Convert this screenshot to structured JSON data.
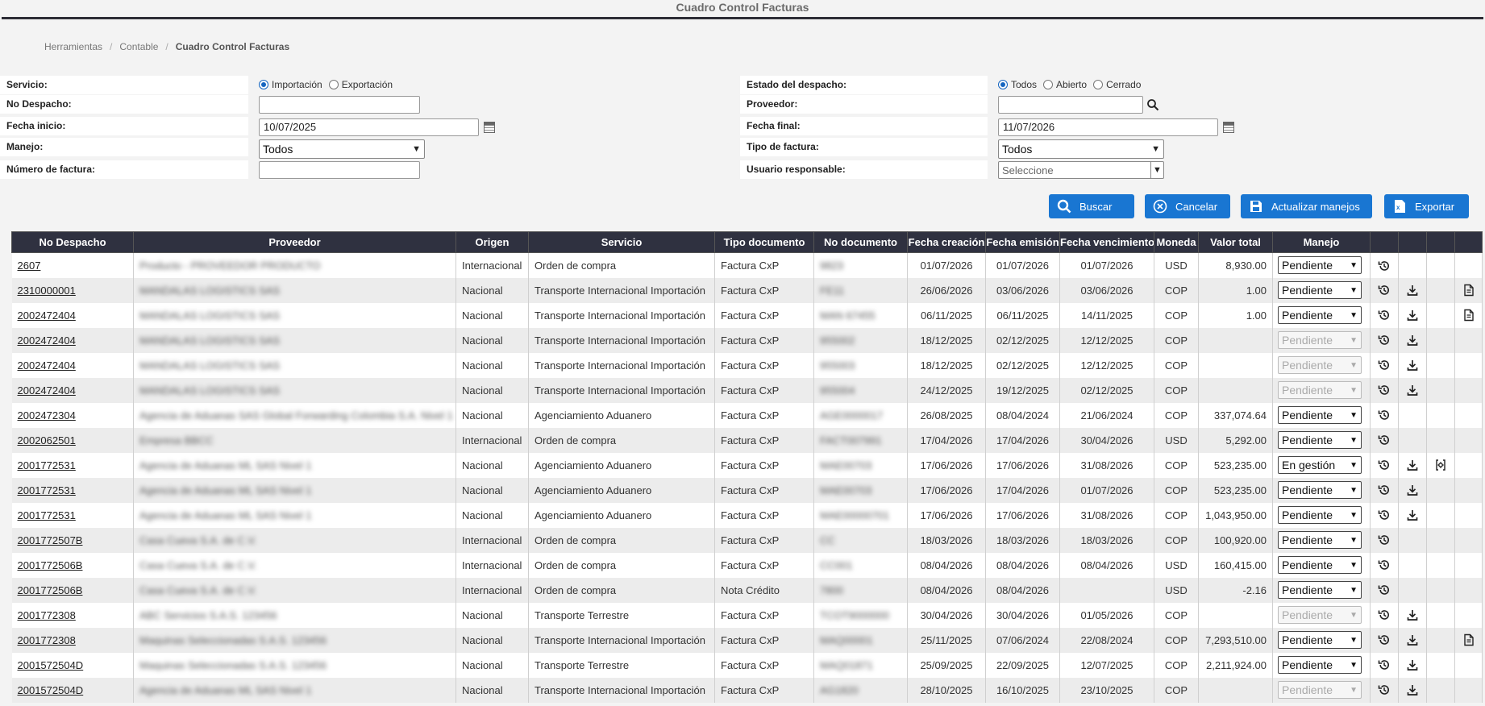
{
  "window": {
    "title": "Cuadro Control Facturas"
  },
  "breadcrumb": {
    "item1": "Herramientas",
    "item2": "Contable",
    "current": "Cuadro Control Facturas",
    "sep": "/"
  },
  "form": {
    "servicio_label": "Servicio:",
    "servicio_opt1": "Importación",
    "servicio_opt2": "Exportación",
    "despacho_label": "No Despacho:",
    "despacho_value": "",
    "fecha_inicio_label": "Fecha inicio:",
    "fecha_inicio_value": "10/07/2025",
    "manejo_label": "Manejo:",
    "manejo_value": "Todos",
    "factura_label": "Número de factura:",
    "factura_value": "",
    "estado_label": "Estado del despacho:",
    "estado_opt1": "Todos",
    "estado_opt2": "Abierto",
    "estado_opt3": "Cerrado",
    "proveedor_label": "Proveedor:",
    "proveedor_value": "",
    "fecha_final_label": "Fecha final:",
    "fecha_final_value": "11/07/2026",
    "tipo_factura_label": "Tipo de factura:",
    "tipo_factura_value": "Todos",
    "usuario_label": "Usuario responsable:",
    "usuario_placeholder": "Seleccione"
  },
  "buttons": {
    "buscar": "Buscar",
    "cancelar": "Cancelar",
    "actualizar": "Actualizar manejos",
    "exportar": "Exportar"
  },
  "colors": {
    "accent": "#1976d2",
    "header": "#2f3140"
  },
  "table": {
    "headers": [
      "No Despacho",
      "Proveedor",
      "Origen",
      "Servicio",
      "Tipo documento",
      "No documento",
      "Fecha creación",
      "Fecha emisión",
      "Fecha vencimiento",
      "Moneda",
      "Valor total",
      "Manejo"
    ],
    "rows": [
      {
        "despacho": "2607",
        "proveedor": "Producto - PROVEEDOR PRODUCTO",
        "origen": "Internacional",
        "servicio": "Orden de compra",
        "tipo": "Factura CxP",
        "nodoc": "9823",
        "creacion": "01/07/2026",
        "emision": "01/07/2026",
        "vencimiento": "01/07/2026",
        "moneda": "USD",
        "valor": "8,930.00",
        "manejo": "Pendiente",
        "dis": false,
        "dl": false,
        "ex": ""
      },
      {
        "despacho": "2310000001",
        "proveedor": "MANDALAS LOGISTICS SAS",
        "origen": "Nacional",
        "servicio": "Transporte Internacional Importación",
        "tipo": "Factura CxP",
        "nodoc": "FE11",
        "creacion": "26/06/2026",
        "emision": "03/06/2026",
        "vencimiento": "03/06/2026",
        "moneda": "COP",
        "valor": "1.00",
        "manejo": "Pendiente",
        "dis": false,
        "dl": true,
        "ex": "doc"
      },
      {
        "despacho": "2002472404",
        "proveedor": "MANDALAS LOGISTICS SAS",
        "origen": "Nacional",
        "servicio": "Transporte Internacional Importación",
        "tipo": "Factura CxP",
        "nodoc": "MAN 67455",
        "creacion": "06/11/2025",
        "emision": "06/11/2025",
        "vencimiento": "14/11/2025",
        "moneda": "COP",
        "valor": "1.00",
        "manejo": "Pendiente",
        "dis": false,
        "dl": true,
        "ex": "doc"
      },
      {
        "despacho": "2002472404",
        "proveedor": "MANDALAS LOGISTICS SAS",
        "origen": "Nacional",
        "servicio": "Transporte Internacional Importación",
        "tipo": "Factura CxP",
        "nodoc": "955002",
        "creacion": "18/12/2025",
        "emision": "02/12/2025",
        "vencimiento": "12/12/2025",
        "moneda": "COP",
        "valor": "",
        "manejo": "Pendiente",
        "dis": true,
        "dl": true,
        "ex": ""
      },
      {
        "despacho": "2002472404",
        "proveedor": "MANDALAS LOGISTICS SAS",
        "origen": "Nacional",
        "servicio": "Transporte Internacional Importación",
        "tipo": "Factura CxP",
        "nodoc": "955003",
        "creacion": "18/12/2025",
        "emision": "02/12/2025",
        "vencimiento": "12/12/2025",
        "moneda": "COP",
        "valor": "",
        "manejo": "Pendiente",
        "dis": true,
        "dl": true,
        "ex": ""
      },
      {
        "despacho": "2002472404",
        "proveedor": "MANDALAS LOGISTICS SAS",
        "origen": "Nacional",
        "servicio": "Transporte Internacional Importación",
        "tipo": "Factura CxP",
        "nodoc": "955004",
        "creacion": "24/12/2025",
        "emision": "19/12/2025",
        "vencimiento": "02/12/2025",
        "moneda": "COP",
        "valor": "",
        "manejo": "Pendiente",
        "dis": true,
        "dl": true,
        "ex": ""
      },
      {
        "despacho": "2002472304",
        "proveedor": "Agencia de Aduanas SAS Global Forwarding Colombia S.A. Nivel 1",
        "origen": "Nacional",
        "servicio": "Agenciamiento Aduanero",
        "tipo": "Factura CxP",
        "nodoc": "AGE0000017",
        "creacion": "26/08/2025",
        "emision": "08/04/2024",
        "vencimiento": "21/06/2024",
        "moneda": "COP",
        "valor": "337,074.64",
        "manejo": "Pendiente",
        "dis": false,
        "dl": false,
        "ex": ""
      },
      {
        "despacho": "2002062501",
        "proveedor": "Empresa BBCC",
        "origen": "Internacional",
        "servicio": "Orden de compra",
        "tipo": "Factura CxP",
        "nodoc": "FACT007991",
        "creacion": "17/04/2026",
        "emision": "17/04/2026",
        "vencimiento": "30/04/2026",
        "moneda": "USD",
        "valor": "5,292.00",
        "manejo": "Pendiente",
        "dis": false,
        "dl": false,
        "ex": ""
      },
      {
        "despacho": "2001772531",
        "proveedor": "Agencia de Aduanas ML SAS Nivel 1",
        "origen": "Nacional",
        "servicio": "Agenciamiento Aduanero",
        "tipo": "Factura CxP",
        "nodoc": "MAE00703",
        "creacion": "17/06/2026",
        "emision": "17/06/2026",
        "vencimiento": "31/08/2026",
        "moneda": "COP",
        "valor": "523,235.00",
        "manejo": "En gestión",
        "dis": false,
        "dl": true,
        "ex": "gear"
      },
      {
        "despacho": "2001772531",
        "proveedor": "Agencia de Aduanas ML SAS Nivel 1",
        "origen": "Nacional",
        "servicio": "Agenciamiento Aduanero",
        "tipo": "Factura CxP",
        "nodoc": "MAE00703",
        "creacion": "17/06/2026",
        "emision": "17/04/2026",
        "vencimiento": "01/07/2026",
        "moneda": "COP",
        "valor": "523,235.00",
        "manejo": "Pendiente",
        "dis": false,
        "dl": true,
        "ex": ""
      },
      {
        "despacho": "2001772531",
        "proveedor": "Agencia de Aduanas ML SAS Nivel 1",
        "origen": "Nacional",
        "servicio": "Agenciamiento Aduanero",
        "tipo": "Factura CxP",
        "nodoc": "MAE00000701",
        "creacion": "17/06/2026",
        "emision": "17/06/2026",
        "vencimiento": "31/08/2026",
        "moneda": "COP",
        "valor": "1,043,950.00",
        "manejo": "Pendiente",
        "dis": false,
        "dl": true,
        "ex": ""
      },
      {
        "despacho": "2001772507B",
        "proveedor": "Casa Cueva S.A. de C.V.",
        "origen": "Internacional",
        "servicio": "Orden de compra",
        "tipo": "Factura CxP",
        "nodoc": "CC",
        "creacion": "18/03/2026",
        "emision": "18/03/2026",
        "vencimiento": "18/03/2026",
        "moneda": "COP",
        "valor": "100,920.00",
        "manejo": "Pendiente",
        "dis": false,
        "dl": false,
        "ex": ""
      },
      {
        "despacho": "2001772506B",
        "proveedor": "Casa Cueva S.A. de C.V.",
        "origen": "Internacional",
        "servicio": "Orden de compra",
        "tipo": "Factura CxP",
        "nodoc": "CC001",
        "creacion": "08/04/2026",
        "emision": "08/04/2026",
        "vencimiento": "08/04/2026",
        "moneda": "USD",
        "valor": "160,415.00",
        "manejo": "Pendiente",
        "dis": false,
        "dl": false,
        "ex": ""
      },
      {
        "despacho": "2001772506B",
        "proveedor": "Casa Cueva S.A. de C.V.",
        "origen": "Internacional",
        "servicio": "Orden de compra",
        "tipo": "Nota Crédito",
        "nodoc": "7800",
        "creacion": "08/04/2026",
        "emision": "08/04/2026",
        "vencimiento": "",
        "moneda": "USD",
        "valor": "-2.16",
        "manejo": "Pendiente",
        "dis": false,
        "dl": false,
        "ex": ""
      },
      {
        "despacho": "2001772308",
        "proveedor": "ABC Servicios S.A.S. 123456",
        "origen": "Nacional",
        "servicio": "Transporte Terrestre",
        "tipo": "Factura CxP",
        "nodoc": "TCOT9000000",
        "creacion": "30/04/2026",
        "emision": "30/04/2026",
        "vencimiento": "01/05/2026",
        "moneda": "COP",
        "valor": "",
        "manejo": "Pendiente",
        "dis": true,
        "dl": true,
        "ex": ""
      },
      {
        "despacho": "2001772308",
        "proveedor": "Maquinas Seleccionadas S.A.S. 123456",
        "origen": "Nacional",
        "servicio": "Transporte Internacional Importación",
        "tipo": "Factura CxP",
        "nodoc": "MAQ00001",
        "creacion": "25/11/2025",
        "emision": "07/06/2024",
        "vencimiento": "22/08/2024",
        "moneda": "COP",
        "valor": "7,293,510.00",
        "manejo": "Pendiente",
        "dis": false,
        "dl": true,
        "ex": "doc"
      },
      {
        "despacho": "2001572504D",
        "proveedor": "Maquinas Seleccionadas S.A.S. 123456",
        "origen": "Nacional",
        "servicio": "Transporte Terrestre",
        "tipo": "Factura CxP",
        "nodoc": "MAQ01871",
        "creacion": "25/09/2025",
        "emision": "22/09/2025",
        "vencimiento": "12/07/2025",
        "moneda": "COP",
        "valor": "2,211,924.00",
        "manejo": "Pendiente",
        "dis": false,
        "dl": true,
        "ex": ""
      },
      {
        "despacho": "2001572504D",
        "proveedor": "Agencia de Aduanas ML SAS Nivel 1",
        "origen": "Nacional",
        "servicio": "Transporte Internacional Importación",
        "tipo": "Factura CxP",
        "nodoc": "AG1820",
        "creacion": "28/10/2025",
        "emision": "16/10/2025",
        "vencimiento": "23/10/2025",
        "moneda": "COP",
        "valor": "",
        "manejo": "Pendiente",
        "dis": true,
        "dl": true,
        "ex": ""
      }
    ]
  }
}
